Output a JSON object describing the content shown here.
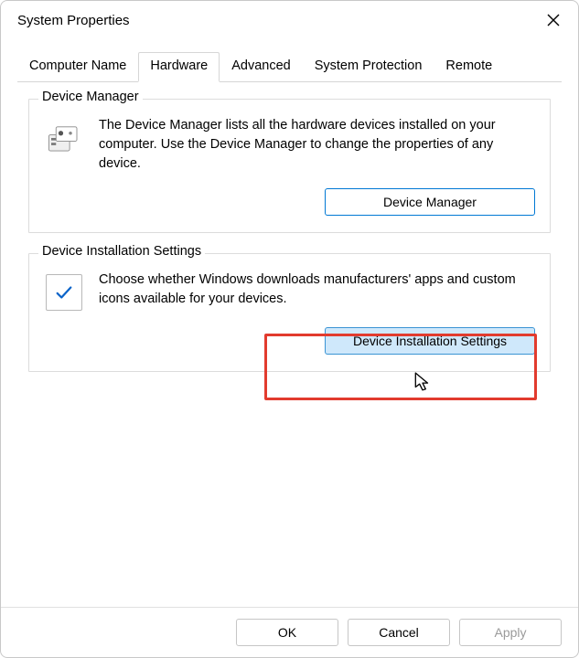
{
  "window": {
    "title": "System Properties"
  },
  "tabs": {
    "items": [
      {
        "label": "Computer Name"
      },
      {
        "label": "Hardware",
        "active": true
      },
      {
        "label": "Advanced"
      },
      {
        "label": "System Protection"
      },
      {
        "label": "Remote"
      }
    ]
  },
  "device_manager_group": {
    "title": "Device Manager",
    "description": "The Device Manager lists all the hardware devices installed on your computer. Use the Device Manager to change the properties of any device.",
    "button_label": "Device Manager"
  },
  "install_settings_group": {
    "title": "Device Installation Settings",
    "description": "Choose whether Windows downloads manufacturers' apps and custom icons available for your devices.",
    "button_label": "Device Installation Settings"
  },
  "footer": {
    "ok": "OK",
    "cancel": "Cancel",
    "apply": "Apply"
  }
}
